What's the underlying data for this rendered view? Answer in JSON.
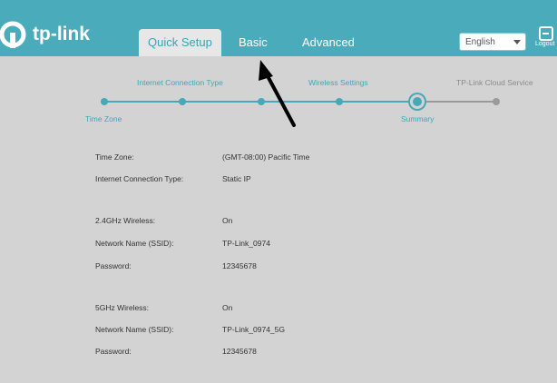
{
  "header": {
    "brand": "tp-link",
    "tabs": [
      {
        "label": "Quick Setup",
        "active": true
      },
      {
        "label": "Basic",
        "active": false
      },
      {
        "label": "Advanced",
        "active": false
      }
    ],
    "language": "English",
    "logout_label": "Logout"
  },
  "wizard": {
    "steps": [
      {
        "label": "Time Zone",
        "state": "done"
      },
      {
        "label": "Internet Connection Type",
        "state": "done"
      },
      {
        "label": "Wireless Settings",
        "state": "done"
      },
      {
        "label": "Summary",
        "state": "current"
      },
      {
        "label": "TP-Link Cloud Service",
        "state": "pending"
      }
    ]
  },
  "summary": [
    {
      "label": "Time Zone:",
      "value": "(GMT-08:00) Pacific Time"
    },
    {
      "label": "Internet Connection Type:",
      "value": "Static IP"
    },
    {
      "label": "2.4GHz Wireless:",
      "value": "On"
    },
    {
      "label": "Network Name (SSID):",
      "value": "TP-Link_0974"
    },
    {
      "label": "Password:",
      "value": "12345678"
    },
    {
      "label": "5GHz Wireless:",
      "value": "On"
    },
    {
      "label": "Network Name (SSID):",
      "value": "TP-Link_0974_5G"
    },
    {
      "label": "Password:",
      "value": "12345678"
    }
  ],
  "colors": {
    "header": "#4aacbb",
    "accent": "#47a8b7",
    "inactive": "#9a9a9a",
    "annotation_arrow": "#000000"
  },
  "icons": [
    "tp-link-logo-icon",
    "chevron-down-icon",
    "logout-icon",
    "annotation-arrow-icon"
  ]
}
